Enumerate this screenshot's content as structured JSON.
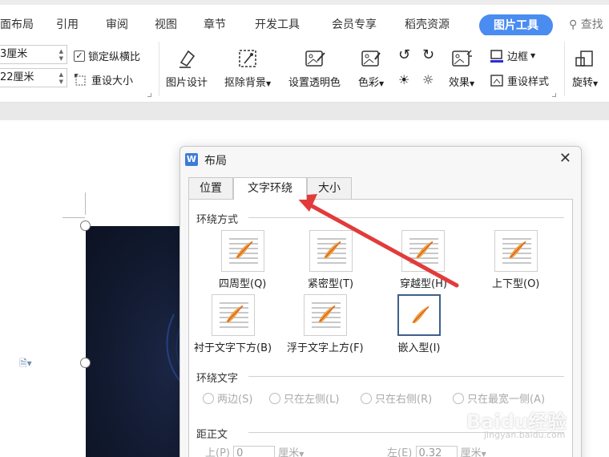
{
  "menu": {
    "items": [
      "面布局",
      "引用",
      "审阅",
      "视图",
      "章节",
      "开发工具",
      "会员专享",
      "稻壳资源"
    ],
    "active_tab": "图片工具",
    "search_label": "查找"
  },
  "toolbar": {
    "width_value": "3厘米",
    "height_value": "22厘米",
    "lock_ratio_label": "锁定纵横比",
    "reset_size_label": "重设大小",
    "picture_design_label": "图片设计",
    "remove_background_label": "抠除背景",
    "set_transparent_label": "设置透明色",
    "color_label": "色彩",
    "effects_label": "效果",
    "border_label": "边框",
    "reset_style_label": "重设样式",
    "rotate_label": "旋转"
  },
  "dialog": {
    "title": "布局",
    "tabs": [
      "位置",
      "文字环绕",
      "大小"
    ],
    "active_tab": "文字环绕",
    "wrap_style_label": "环绕方式",
    "wrap_options": [
      "四周型(Q)",
      "紧密型(T)",
      "穿越型(H)",
      "上下型(O)",
      "衬于文字下方(B)",
      "浮于文字上方(F)",
      "嵌入型(I)"
    ],
    "selected_option": "嵌入型(I)",
    "wrap_text_label": "环绕文字",
    "wrap_text_options": [
      "两边(S)",
      "只在左侧(L)",
      "只在右侧(R)",
      "只在最宽一侧(A)"
    ],
    "distance_label": "距正文",
    "top_label": "上(P)",
    "top_value": "0",
    "left_label": "左(E)",
    "left_value": "0.32",
    "unit": "厘米"
  },
  "watermark": {
    "text": "Baidu经验",
    "sub": "jingyan.baidu.com"
  },
  "colors": {
    "accent": "#4a8cf0",
    "arrow": "#e23b3b",
    "selected_border": "#3f5f8a"
  }
}
